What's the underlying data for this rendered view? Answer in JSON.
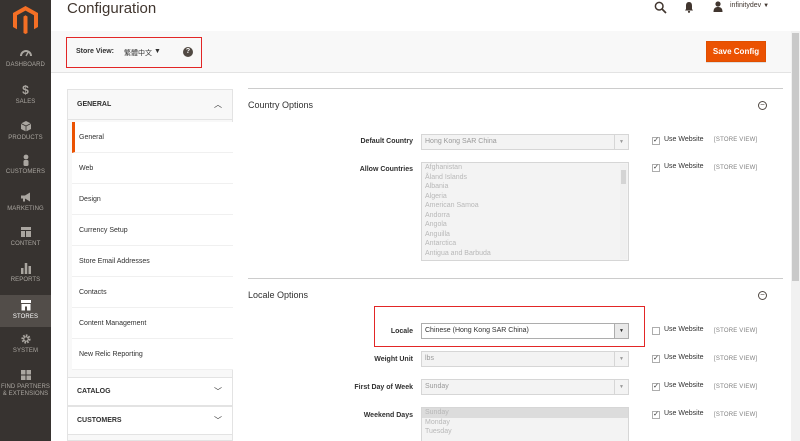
{
  "header": {
    "title": "Configuration",
    "user": "infinitydev"
  },
  "nav": {
    "items": [
      {
        "label": "DASHBOARD",
        "icon": "dashboard-icon"
      },
      {
        "label": "SALES",
        "icon": "dollar-icon"
      },
      {
        "label": "PRODUCTS",
        "icon": "cube-icon"
      },
      {
        "label": "CUSTOMERS",
        "icon": "person-icon"
      },
      {
        "label": "MARKETING",
        "icon": "megaphone-icon"
      },
      {
        "label": "CONTENT",
        "icon": "layout-icon"
      },
      {
        "label": "REPORTS",
        "icon": "bar-chart-icon"
      },
      {
        "label": "STORES",
        "icon": "store-icon"
      },
      {
        "label": "SYSTEM",
        "icon": "gear-icon"
      },
      {
        "label1": "FIND PARTNERS",
        "label2": "& EXTENSIONS",
        "icon": "partners-icon"
      }
    ]
  },
  "store_bar": {
    "label": "Store View:",
    "value": "繁體中文",
    "save": "Save Config"
  },
  "sidebar": {
    "general_title": "GENERAL",
    "links": [
      "General",
      "Web",
      "Design",
      "Currency Setup",
      "Store Email Addresses",
      "Contacts",
      "Content Management",
      "New Relic Reporting"
    ],
    "catalog": "CATALOG",
    "customers": "CUSTOMERS"
  },
  "country": {
    "title": "Country Options",
    "default_label": "Default Country",
    "default_value": "Hong Kong SAR China",
    "allow_label": "Allow Countries",
    "countries": [
      "Afghanistan",
      "Åland Islands",
      "Albania",
      "Algeria",
      "American Samoa",
      "Andorra",
      "Angola",
      "Anguilla",
      "Antarctica",
      "Antigua and Barbuda"
    ]
  },
  "locale": {
    "title": "Locale Options",
    "locale_label": "Locale",
    "locale_value": "Chinese (Hong Kong SAR China)",
    "weight_label": "Weight Unit",
    "weight_value": "lbs",
    "firstday_label": "First Day of Week",
    "firstday_value": "Sunday",
    "weekend_label": "Weekend Days",
    "weekend_days": [
      "Sunday",
      "Monday",
      "Tuesday"
    ]
  },
  "common": {
    "use_website": "Use Website",
    "scope": "[STORE VIEW]"
  }
}
